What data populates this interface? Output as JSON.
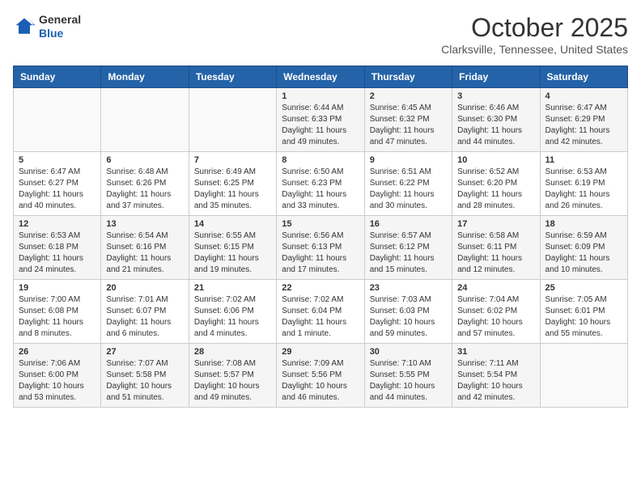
{
  "header": {
    "logo_line1": "General",
    "logo_line2": "Blue",
    "month_title": "October 2025",
    "location": "Clarksville, Tennessee, United States"
  },
  "weekdays": [
    "Sunday",
    "Monday",
    "Tuesday",
    "Wednesday",
    "Thursday",
    "Friday",
    "Saturday"
  ],
  "weeks": [
    [
      {
        "day": "",
        "info": ""
      },
      {
        "day": "",
        "info": ""
      },
      {
        "day": "",
        "info": ""
      },
      {
        "day": "1",
        "info": "Sunrise: 6:44 AM\nSunset: 6:33 PM\nDaylight: 11 hours\nand 49 minutes."
      },
      {
        "day": "2",
        "info": "Sunrise: 6:45 AM\nSunset: 6:32 PM\nDaylight: 11 hours\nand 47 minutes."
      },
      {
        "day": "3",
        "info": "Sunrise: 6:46 AM\nSunset: 6:30 PM\nDaylight: 11 hours\nand 44 minutes."
      },
      {
        "day": "4",
        "info": "Sunrise: 6:47 AM\nSunset: 6:29 PM\nDaylight: 11 hours\nand 42 minutes."
      }
    ],
    [
      {
        "day": "5",
        "info": "Sunrise: 6:47 AM\nSunset: 6:27 PM\nDaylight: 11 hours\nand 40 minutes."
      },
      {
        "day": "6",
        "info": "Sunrise: 6:48 AM\nSunset: 6:26 PM\nDaylight: 11 hours\nand 37 minutes."
      },
      {
        "day": "7",
        "info": "Sunrise: 6:49 AM\nSunset: 6:25 PM\nDaylight: 11 hours\nand 35 minutes."
      },
      {
        "day": "8",
        "info": "Sunrise: 6:50 AM\nSunset: 6:23 PM\nDaylight: 11 hours\nand 33 minutes."
      },
      {
        "day": "9",
        "info": "Sunrise: 6:51 AM\nSunset: 6:22 PM\nDaylight: 11 hours\nand 30 minutes."
      },
      {
        "day": "10",
        "info": "Sunrise: 6:52 AM\nSunset: 6:20 PM\nDaylight: 11 hours\nand 28 minutes."
      },
      {
        "day": "11",
        "info": "Sunrise: 6:53 AM\nSunset: 6:19 PM\nDaylight: 11 hours\nand 26 minutes."
      }
    ],
    [
      {
        "day": "12",
        "info": "Sunrise: 6:53 AM\nSunset: 6:18 PM\nDaylight: 11 hours\nand 24 minutes."
      },
      {
        "day": "13",
        "info": "Sunrise: 6:54 AM\nSunset: 6:16 PM\nDaylight: 11 hours\nand 21 minutes."
      },
      {
        "day": "14",
        "info": "Sunrise: 6:55 AM\nSunset: 6:15 PM\nDaylight: 11 hours\nand 19 minutes."
      },
      {
        "day": "15",
        "info": "Sunrise: 6:56 AM\nSunset: 6:13 PM\nDaylight: 11 hours\nand 17 minutes."
      },
      {
        "day": "16",
        "info": "Sunrise: 6:57 AM\nSunset: 6:12 PM\nDaylight: 11 hours\nand 15 minutes."
      },
      {
        "day": "17",
        "info": "Sunrise: 6:58 AM\nSunset: 6:11 PM\nDaylight: 11 hours\nand 12 minutes."
      },
      {
        "day": "18",
        "info": "Sunrise: 6:59 AM\nSunset: 6:09 PM\nDaylight: 11 hours\nand 10 minutes."
      }
    ],
    [
      {
        "day": "19",
        "info": "Sunrise: 7:00 AM\nSunset: 6:08 PM\nDaylight: 11 hours\nand 8 minutes."
      },
      {
        "day": "20",
        "info": "Sunrise: 7:01 AM\nSunset: 6:07 PM\nDaylight: 11 hours\nand 6 minutes."
      },
      {
        "day": "21",
        "info": "Sunrise: 7:02 AM\nSunset: 6:06 PM\nDaylight: 11 hours\nand 4 minutes."
      },
      {
        "day": "22",
        "info": "Sunrise: 7:02 AM\nSunset: 6:04 PM\nDaylight: 11 hours\nand 1 minute."
      },
      {
        "day": "23",
        "info": "Sunrise: 7:03 AM\nSunset: 6:03 PM\nDaylight: 10 hours\nand 59 minutes."
      },
      {
        "day": "24",
        "info": "Sunrise: 7:04 AM\nSunset: 6:02 PM\nDaylight: 10 hours\nand 57 minutes."
      },
      {
        "day": "25",
        "info": "Sunrise: 7:05 AM\nSunset: 6:01 PM\nDaylight: 10 hours\nand 55 minutes."
      }
    ],
    [
      {
        "day": "26",
        "info": "Sunrise: 7:06 AM\nSunset: 6:00 PM\nDaylight: 10 hours\nand 53 minutes."
      },
      {
        "day": "27",
        "info": "Sunrise: 7:07 AM\nSunset: 5:58 PM\nDaylight: 10 hours\nand 51 minutes."
      },
      {
        "day": "28",
        "info": "Sunrise: 7:08 AM\nSunset: 5:57 PM\nDaylight: 10 hours\nand 49 minutes."
      },
      {
        "day": "29",
        "info": "Sunrise: 7:09 AM\nSunset: 5:56 PM\nDaylight: 10 hours\nand 46 minutes."
      },
      {
        "day": "30",
        "info": "Sunrise: 7:10 AM\nSunset: 5:55 PM\nDaylight: 10 hours\nand 44 minutes."
      },
      {
        "day": "31",
        "info": "Sunrise: 7:11 AM\nSunset: 5:54 PM\nDaylight: 10 hours\nand 42 minutes."
      },
      {
        "day": "",
        "info": ""
      }
    ]
  ]
}
